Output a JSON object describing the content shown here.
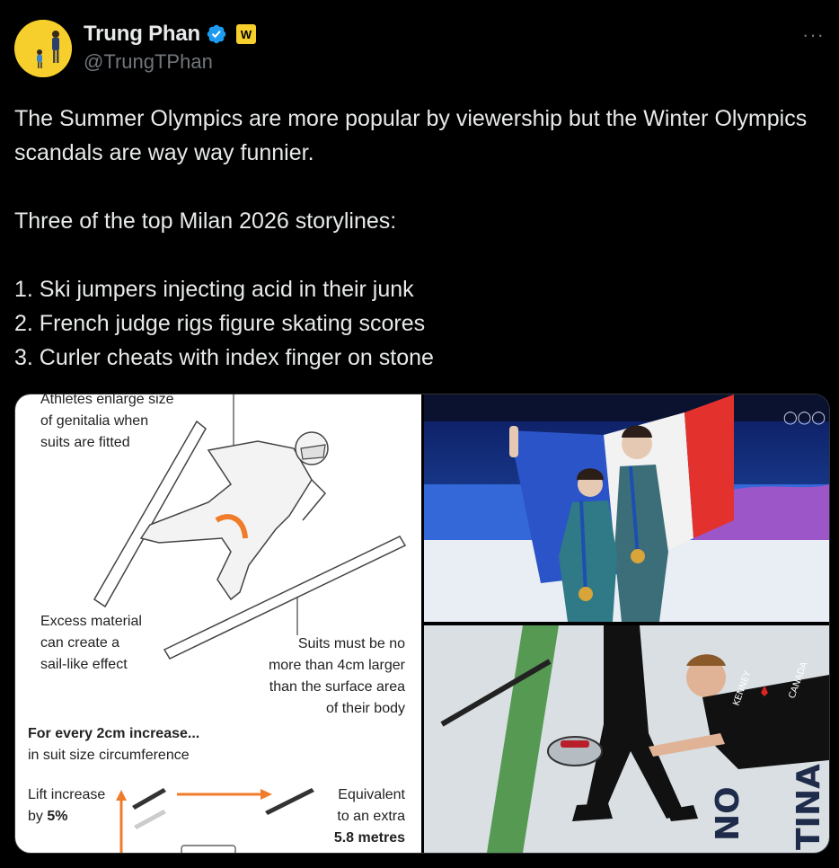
{
  "author": {
    "name": "Trung Phan",
    "handle": "@TrungTPhan",
    "affiliate_badge": "W"
  },
  "more_label": "···",
  "tweet": {
    "text": "The Summer Olympics are more popular by viewership but the Winter Olympics scandals are way way funnier.\n\nThree of the top Milan 2026 storylines:\n\n1. Ski jumpers injecting acid in their junk\n2. French judge rigs figure skating scores\n3. Curler cheats with index finger on stone"
  },
  "infographic": {
    "note_top": "Athletes enlarge size\nof genitalia when\nsuits are fitted",
    "note_sail": "Excess material\ncan create a\nsail-like effect",
    "note_suits": "Suits must be no\nmore than 4cm larger\nthan the surface area\nof their body",
    "increase_heading": "For every 2cm increase...",
    "increase_sub": "in suit size circumference",
    "lift_label": "Lift increase",
    "lift_by": "by ",
    "lift_value": "5%",
    "equiv_line1": "Equivalent",
    "equiv_line2": "to an extra",
    "equiv_value": "5.8 metres"
  },
  "curling_text": {
    "kenney": "KENNEY",
    "canada": "CANADA",
    "venue_left": "NO",
    "venue_right": "TINA"
  },
  "colors": {
    "background": "#000000",
    "text": "#e7e9ea",
    "muted": "#71767b",
    "verified": "#1d9bf0",
    "affiliate": "#f6cf2c",
    "accent_orange": "#f07b2a"
  }
}
